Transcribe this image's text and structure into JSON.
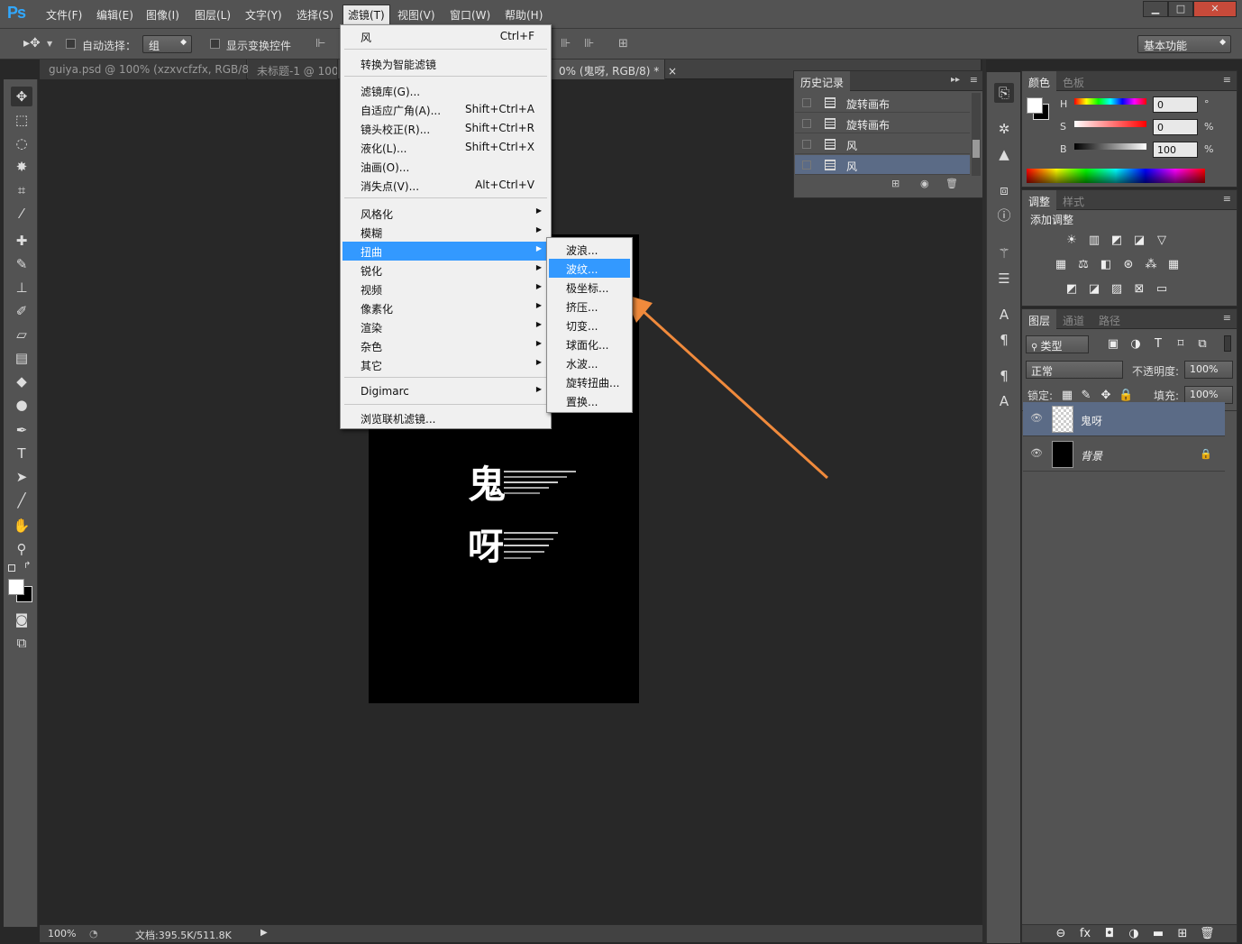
{
  "app": {
    "logo": "Ps"
  },
  "menubar": {
    "items": [
      "文件(F)",
      "编辑(E)",
      "图像(I)",
      "图层(L)",
      "文字(Y)",
      "选择(S)",
      "滤镜(T)",
      "视图(V)",
      "窗口(W)",
      "帮助(H)"
    ],
    "active": "滤镜(T)"
  },
  "window_controls": {
    "minimize": "▁",
    "maximize": "□",
    "close": "✕"
  },
  "options": {
    "auto_select_label": "自动选择：",
    "auto_select_value": "组",
    "show_transform_label": "显示变换控件",
    "workspace": "基本功能"
  },
  "tabs": [
    {
      "label": "guiya.psd @ 100% (xzxvcfzfx, RGB/8)",
      "close": "×",
      "active": false
    },
    {
      "label": "未标题-1 @ 100",
      "close": "",
      "active": false
    },
    {
      "label": "0% (鬼呀, RGB/8) *",
      "close": "×",
      "active": true
    }
  ],
  "filter_menu": {
    "items": [
      {
        "label": "风",
        "shortcut": "Ctrl+F"
      },
      {
        "label": "转换为智能滤镜",
        "shortcut": ""
      },
      {
        "label": "滤镜库(G)...",
        "shortcut": ""
      },
      {
        "label": "自适应广角(A)...",
        "shortcut": "Shift+Ctrl+A"
      },
      {
        "label": "镜头校正(R)...",
        "shortcut": "Shift+Ctrl+R"
      },
      {
        "label": "液化(L)...",
        "shortcut": "Shift+Ctrl+X"
      },
      {
        "label": "油画(O)...",
        "shortcut": ""
      },
      {
        "label": "消失点(V)...",
        "shortcut": "Alt+Ctrl+V"
      },
      {
        "label": "风格化",
        "shortcut": ""
      },
      {
        "label": "模糊",
        "shortcut": ""
      },
      {
        "label": "扭曲",
        "shortcut": ""
      },
      {
        "label": "锐化",
        "shortcut": ""
      },
      {
        "label": "视频",
        "shortcut": ""
      },
      {
        "label": "像素化",
        "shortcut": ""
      },
      {
        "label": "渲染",
        "shortcut": ""
      },
      {
        "label": "杂色",
        "shortcut": ""
      },
      {
        "label": "其它",
        "shortcut": ""
      },
      {
        "label": "Digimarc",
        "shortcut": ""
      },
      {
        "label": "浏览联机滤镜...",
        "shortcut": ""
      }
    ],
    "submenu_arrow": "▶"
  },
  "distort_submenu": {
    "items": [
      "波浪...",
      "波纹...",
      "极坐标...",
      "挤压...",
      "切变...",
      "球面化...",
      "水波...",
      "旋转扭曲...",
      "置换..."
    ],
    "highlighted": "波纹..."
  },
  "history": {
    "title": "历史记录",
    "menu_icon": "▸▸",
    "rows": [
      {
        "label": "旋转画布",
        "selected": false
      },
      {
        "label": "旋转画布",
        "selected": false
      },
      {
        "label": "风",
        "selected": false
      },
      {
        "label": "风",
        "selected": true
      }
    ]
  },
  "color_panel": {
    "tabs": [
      "颜色",
      "色板"
    ],
    "channels": [
      {
        "name": "H",
        "value": "0",
        "unit": "°"
      },
      {
        "name": "S",
        "value": "0",
        "unit": "%"
      },
      {
        "name": "B",
        "value": "100",
        "unit": "%"
      }
    ]
  },
  "adjust_panel": {
    "tabs": [
      "调整",
      "样式"
    ],
    "heading": "添加调整"
  },
  "layers_panel": {
    "tabs": [
      "图层",
      "通道",
      "路径"
    ],
    "filter": "类型",
    "blend_mode": "正常",
    "opacity_label": "不透明度:",
    "opacity": "100%",
    "lock_label": "锁定:",
    "fill_label": "填充:",
    "fill": "100%",
    "layers": [
      {
        "name": "鬼呀",
        "selected": true,
        "locked": false
      },
      {
        "name": "背景",
        "selected": false,
        "locked": true
      }
    ]
  },
  "status": {
    "zoom": "100%",
    "doc_info": "文档:395.5K/511.8K"
  },
  "canvas_text": {
    "line1": "鬼",
    "line2": "呀"
  },
  "colors": {
    "accent": "#3399ff",
    "arrow": "#f08a3c",
    "selection_row": "#5b6b86"
  }
}
